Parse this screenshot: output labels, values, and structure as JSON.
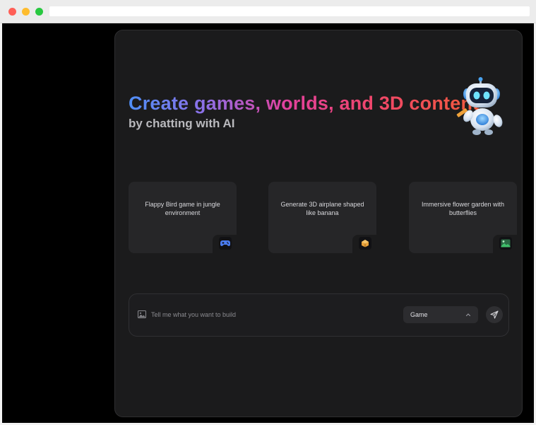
{
  "hero": {
    "title": "Create games, worlds, and 3D content",
    "subtitle": "by chatting with AI",
    "mascot_icon": "robot-mascot-icon"
  },
  "cards": [
    {
      "label": "Flappy Bird game in jungle environment",
      "icon": "gamepad-icon",
      "icon_color": "#4a7cf0"
    },
    {
      "label": "Generate 3D airplane shaped like banana",
      "icon": "cube-3d-icon",
      "icon_color": "#e8a13a"
    },
    {
      "label": "Immersive flower garden with butterflies",
      "icon": "landscape-icon",
      "icon_color": "#3fbf6a"
    }
  ],
  "composer": {
    "placeholder": "Tell me what you want to build",
    "attach_icon": "image-icon",
    "mode_selected": "Game",
    "send_icon": "send-icon"
  },
  "colors": {
    "panel_bg": "#1b1b1c",
    "card_bg": "#262628",
    "gradient": [
      "#4f8ff7",
      "#8e6fe6",
      "#e2419e",
      "#f25a3b"
    ]
  }
}
